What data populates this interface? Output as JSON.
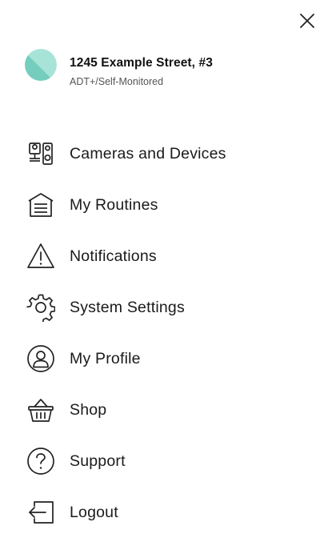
{
  "header": {
    "close_icon": "close-icon"
  },
  "account": {
    "title": "1245 Example Street, #3",
    "subtitle": "ADT+/Self-Monitored",
    "avatar_colors": [
      "#a8e3d8",
      "#6ccab8"
    ]
  },
  "menu": {
    "items": [
      {
        "label": "Cameras and Devices",
        "icon": "cameras-devices-icon"
      },
      {
        "label": "My Routines",
        "icon": "routines-icon"
      },
      {
        "label": "Notifications",
        "icon": "warning-icon"
      },
      {
        "label": "System Settings",
        "icon": "gear-icon"
      },
      {
        "label": "My Profile",
        "icon": "user-profile-icon"
      },
      {
        "label": "Shop",
        "icon": "basket-icon"
      },
      {
        "label": "Support",
        "icon": "question-icon"
      },
      {
        "label": "Logout",
        "icon": "logout-icon"
      }
    ]
  }
}
